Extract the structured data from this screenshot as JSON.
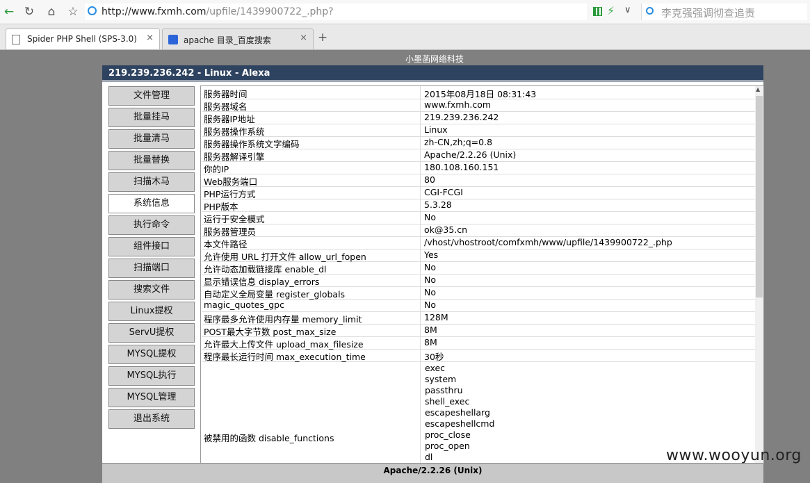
{
  "browser": {
    "url_host": "http://www.fxmh.com",
    "url_path": "/upfile/1439900722_.php?",
    "search_placeholder": "李克强强调彻查追责",
    "tabs": [
      {
        "label": "Spider PHP Shell (SPS-3.0)",
        "active": true
      },
      {
        "label": "apache 目录_百度搜索",
        "active": false
      }
    ],
    "new_tab": "+",
    "close": "×"
  },
  "page": {
    "site_title": "小墨菡网络科技",
    "header": "219.239.236.242 - Linux - Alexa",
    "footer": "Apache/2.2.26 (Unix)",
    "watermark": "www.wooyun.org"
  },
  "sidebar": [
    {
      "label": "文件管理"
    },
    {
      "label": "批量挂马"
    },
    {
      "label": "批量清马"
    },
    {
      "label": "批量替换"
    },
    {
      "label": "扫描木马"
    },
    {
      "label": "系统信息",
      "active": true
    },
    {
      "label": "执行命令"
    },
    {
      "label": "组件接口"
    },
    {
      "label": "扫描端口"
    },
    {
      "label": "搜索文件"
    },
    {
      "label": "Linux提权"
    },
    {
      "label": "ServU提权"
    },
    {
      "label": "MYSQL提权"
    },
    {
      "label": "MYSQL执行"
    },
    {
      "label": "MYSQL管理"
    },
    {
      "label": "退出系统"
    }
  ],
  "info_rows": [
    {
      "key": "服务器时间",
      "value": "2015年08月18日 08:31:43"
    },
    {
      "key": "服务器域名",
      "value": "www.fxmh.com"
    },
    {
      "key": "服务器IP地址",
      "value": "219.239.236.242"
    },
    {
      "key": "服务器操作系统",
      "value": "Linux"
    },
    {
      "key": "服务器操作系统文字编码",
      "value": "zh-CN,zh;q=0.8"
    },
    {
      "key": "服务器解译引擎",
      "value": "Apache/2.2.26 (Unix)"
    },
    {
      "key": "你的IP",
      "value": "180.108.160.151"
    },
    {
      "key": "Web服务端口",
      "value": "80"
    },
    {
      "key": "PHP运行方式",
      "value": "CGI-FCGI"
    },
    {
      "key": "PHP版本",
      "value": "5.3.28"
    },
    {
      "key": "运行于安全模式",
      "value": "No"
    },
    {
      "key": "服务器管理员",
      "value": "ok@35.cn"
    },
    {
      "key": "本文件路径",
      "value": "/vhost/vhostroot/comfxmh/www/upfile/1439900722_.php"
    },
    {
      "key": "允许使用 URL 打开文件 allow_url_fopen",
      "value": "Yes"
    },
    {
      "key": "允许动态加载链接库 enable_dl",
      "value": "No"
    },
    {
      "key": "显示错误信息 display_errors",
      "value": "No"
    },
    {
      "key": "自动定义全局变量 register_globals",
      "value": "No"
    },
    {
      "key": "magic_quotes_gpc",
      "value": "No"
    },
    {
      "key": "程序最多允许使用内存量 memory_limit",
      "value": "128M"
    },
    {
      "key": "POST最大字节数 post_max_size",
      "value": "8M"
    },
    {
      "key": "允许最大上传文件 upload_max_filesize",
      "value": "8M"
    },
    {
      "key": "程序最长运行时间 max_execution_time",
      "value": "30秒"
    }
  ],
  "disabled": {
    "key": "被禁用的函数 disable_functions",
    "values": [
      "exec",
      "system",
      "passthru",
      "shell_exec",
      "escapeshellarg",
      "escapeshellcmd",
      "proc_close",
      "proc_open",
      "dl"
    ]
  }
}
